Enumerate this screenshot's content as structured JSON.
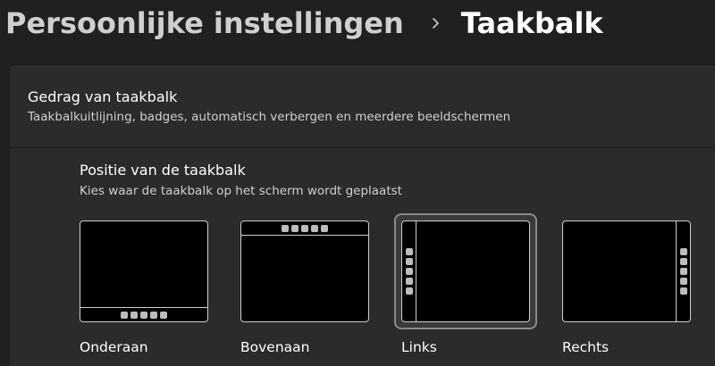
{
  "breadcrumb": {
    "parent": "Persoonlijke instellingen",
    "current": "Taakbalk",
    "separator_icon": "chevron-right-icon"
  },
  "card": {
    "title": "Gedrag van taakbalk",
    "subtitle": "Taakbalkuitlijning, badges, automatisch verbergen en meerdere beeldschermen"
  },
  "position_section": {
    "title": "Positie van de taakbalk",
    "subtitle": "Kies waar de taakbalk op het scherm wordt geplaatst",
    "options": [
      {
        "label": "Onderaan",
        "position": "bottom",
        "selected": false
      },
      {
        "label": "Bovenaan",
        "position": "top",
        "selected": false
      },
      {
        "label": "Links",
        "position": "left",
        "selected": true
      },
      {
        "label": "Rechts",
        "position": "right",
        "selected": false
      }
    ]
  },
  "colors": {
    "background": "#202020",
    "card": "#2b2b2b",
    "selected_border": "#8a8a8a"
  }
}
